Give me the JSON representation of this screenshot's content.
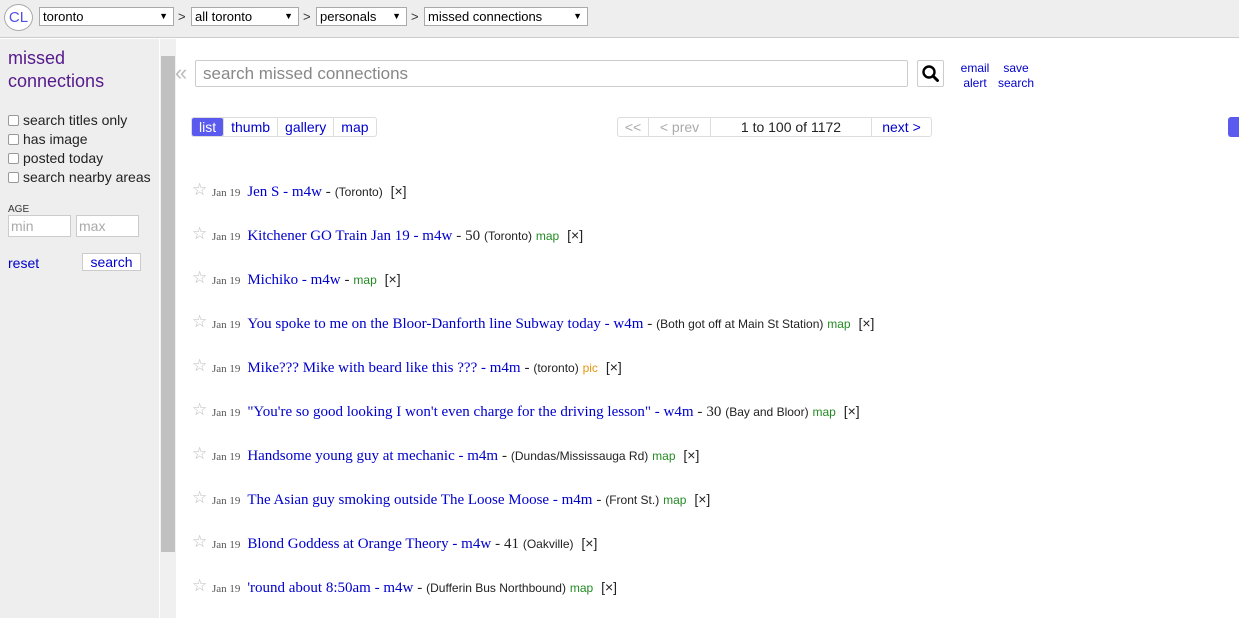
{
  "header": {
    "logo": "CL",
    "breadcrumbs": [
      "toronto",
      "all toronto",
      "personals",
      "missed connections"
    ],
    "separator": ">"
  },
  "sidebar": {
    "title": "missed connections",
    "checkboxes": [
      "search titles only",
      "has image",
      "posted today",
      "search nearby areas"
    ],
    "age_label": "AGE",
    "age_min_placeholder": "min",
    "age_max_placeholder": "max",
    "reset_label": "reset",
    "search_label": "search"
  },
  "search": {
    "collapse_glyph": "«",
    "placeholder": "search missed connections",
    "email_alert": [
      "email",
      "alert"
    ],
    "save_search": [
      "save",
      "search"
    ]
  },
  "views": [
    "list",
    "thumb",
    "gallery",
    "map"
  ],
  "active_view": "list",
  "pagination": {
    "first": "<<",
    "prev": "< prev",
    "range": "1 to 100 of 1172",
    "next": "next >"
  },
  "results": [
    {
      "date": "Jan 19",
      "title": "Jen S - m4w",
      "price": "",
      "hood": "(Toronto)",
      "tag": ""
    },
    {
      "date": "Jan 19",
      "title": "Kitchener GO Train Jan 19 - m4w",
      "price": "50",
      "hood": "(Toronto)",
      "tag": "map"
    },
    {
      "date": "Jan 19",
      "title": "Michiko - m4w",
      "price": "",
      "hood": "",
      "tag": "map"
    },
    {
      "date": "Jan 19",
      "title": "You spoke to me on the Bloor-Danforth line Subway today - w4m",
      "price": "",
      "hood": "(Both got off at Main St Station)",
      "tag": "map"
    },
    {
      "date": "Jan 19",
      "title": "Mike??? Mike with beard like this ??? - m4m",
      "price": "",
      "hood": "(toronto)",
      "tag": "pic"
    },
    {
      "date": "Jan 19",
      "title": "\"You're so good looking I won't even charge for the driving lesson\" - w4m",
      "price": "30",
      "hood": "(Bay and Bloor)",
      "tag": "map"
    },
    {
      "date": "Jan 19",
      "title": "Handsome young guy at mechanic - m4m",
      "price": "",
      "hood": "(Dundas/Mississauga Rd)",
      "tag": "map"
    },
    {
      "date": "Jan 19",
      "title": "The Asian guy smoking outside The Loose Moose - m4m",
      "price": "",
      "hood": "(Front St.)",
      "tag": "map"
    },
    {
      "date": "Jan 19",
      "title": "Blond Goddess at Orange Theory - m4w",
      "price": "41",
      "hood": "(Oakville)",
      "tag": ""
    },
    {
      "date": "Jan 19",
      "title": "'round about 8:50am - m4w",
      "price": "",
      "hood": "(Dufferin Bus Northbound)",
      "tag": "map"
    }
  ],
  "hide_glyph": "[×]",
  "star_glyph": "☆"
}
